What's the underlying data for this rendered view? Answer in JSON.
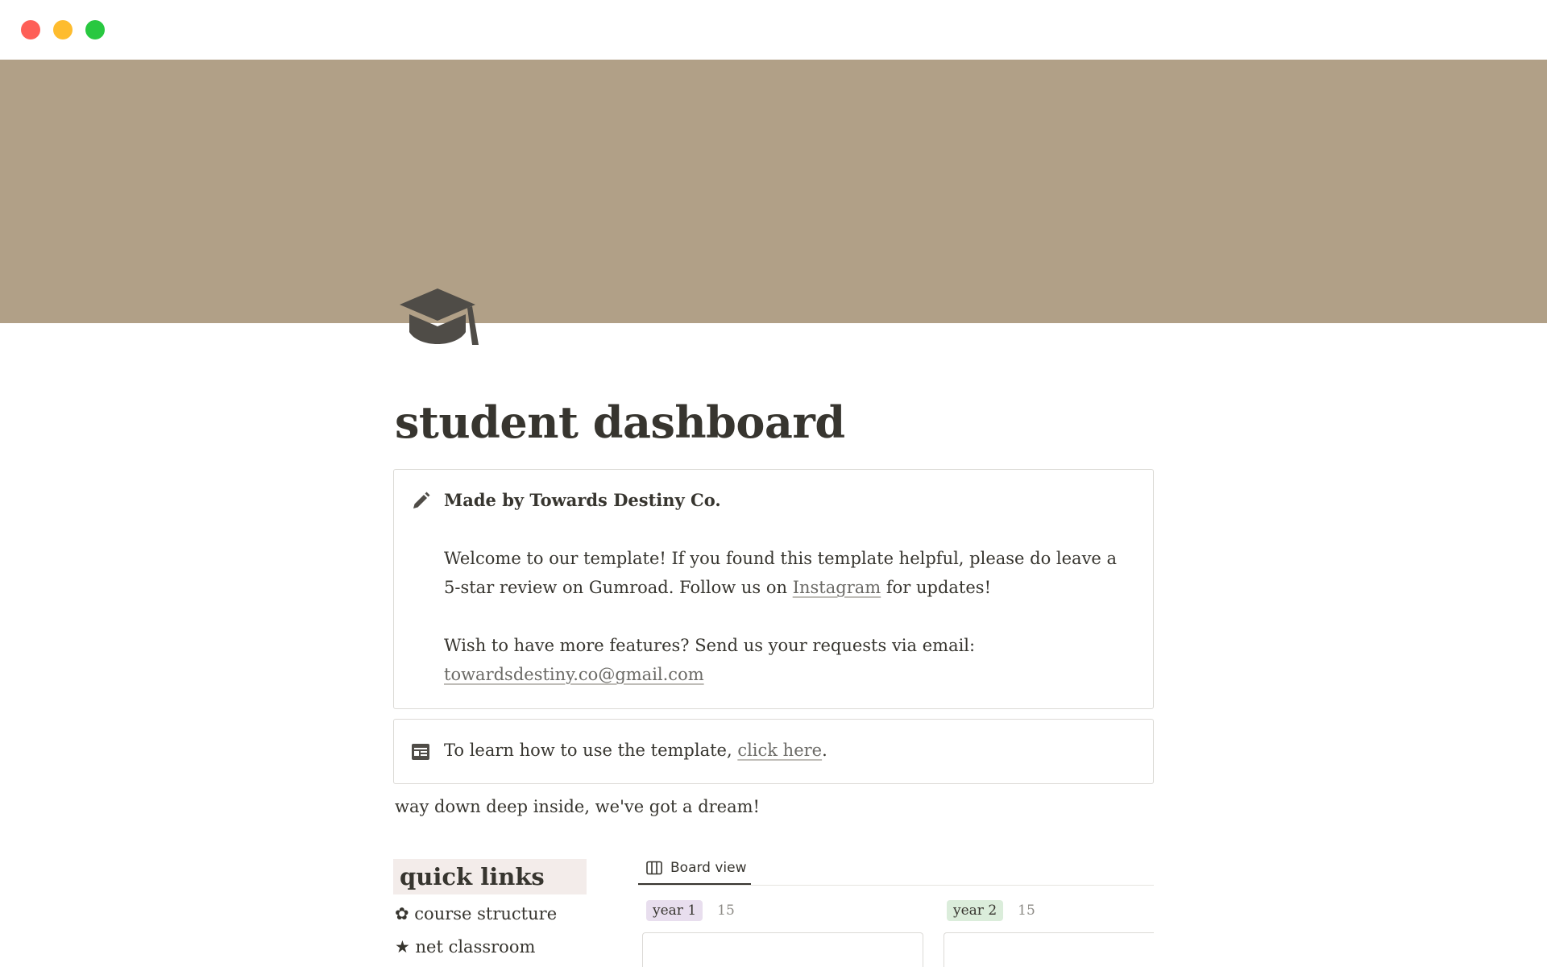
{
  "window": {
    "controls": [
      "close",
      "minimize",
      "zoom"
    ]
  },
  "page": {
    "icon": "graduation-cap-icon",
    "title": "student dashboard"
  },
  "callout_main": {
    "icon": "pencil-icon",
    "heading": "Made by Towards Destiny Co.",
    "welcome_before_link": "Welcome to our template! If you found this template helpful, please do leave a 5-star review on Gumroad. Follow us on ",
    "instagram_link": "Instagram",
    "welcome_after_link": " for updates!",
    "features_text": "Wish to have more features? Send us your requests via email:",
    "email_link": "towardsdestiny.co@gmail.com"
  },
  "callout_guide": {
    "icon": "newspaper-icon",
    "text_before_link": "To learn how to use the template, ",
    "link": "click here",
    "text_after_link": "."
  },
  "quote": "way down deep inside, we've got a dream!",
  "quick_links": {
    "heading": "quick links",
    "items": [
      {
        "glyph": "✿",
        "label": "course structure"
      },
      {
        "glyph": "★",
        "label": "net classroom"
      }
    ]
  },
  "board": {
    "view_tab": "Board view",
    "view_icon": "board-columns-icon",
    "groups": [
      {
        "label": "year 1",
        "count": "15",
        "color": "#e8deee"
      },
      {
        "label": "year 2",
        "count": "15",
        "color": "#dbeddb"
      }
    ]
  },
  "colors": {
    "cover": "#b1a087",
    "text": "#37352f",
    "link": "#6b6a66",
    "quick_links_bg": "#f3ecea"
  }
}
